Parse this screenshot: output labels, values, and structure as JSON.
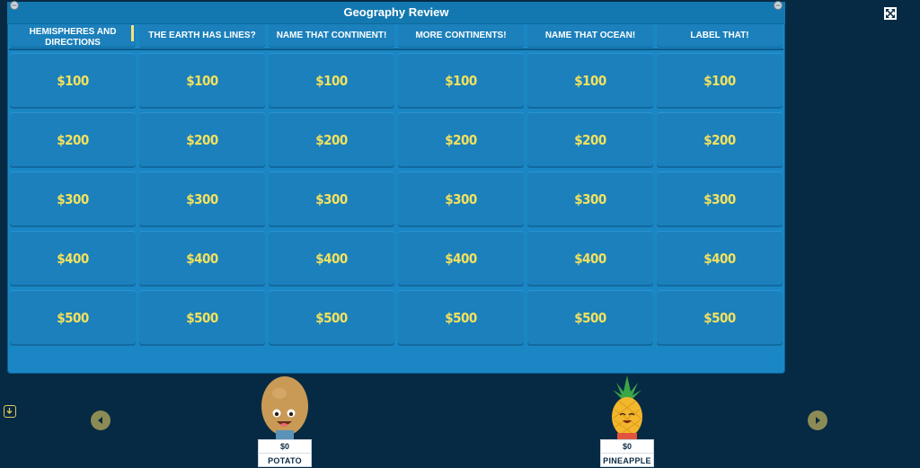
{
  "game": {
    "title": "Geography Review"
  },
  "categories": [
    "HEMISPHERES AND DIRECTIONS",
    "THE EARTH HAS LINES?",
    "NAME THAT CONTINENT!",
    "MORE CONTINENTS!",
    "NAME THAT OCEAN!",
    "LABEL THAT!"
  ],
  "values": [
    "$100",
    "$200",
    "$300",
    "$400",
    "$500"
  ],
  "players": [
    {
      "name": "POTATO",
      "score": "$0",
      "icon": "potato-avatar"
    },
    {
      "name": "PINEAPPLE",
      "score": "$0",
      "icon": "pineapple-avatar"
    }
  ],
  "icons": {
    "fullscreen": "fullscreen-icon",
    "side": "download-icon",
    "prev": "chevron-left-icon",
    "next": "chevron-right-icon"
  },
  "colors": {
    "background": "#062a44",
    "board": "#1a87c4",
    "tile": "#1b80bb",
    "value_text": "#f4e15e"
  }
}
